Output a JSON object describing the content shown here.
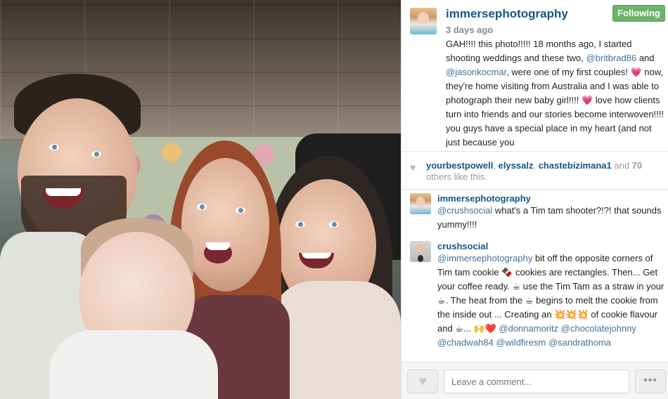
{
  "post": {
    "username": "immersephotography",
    "follow_label": "Following",
    "time_ago": "3 days ago",
    "caption": {
      "p1": "GAH!!!! this photo!!!!! 18 months ago, I started shooting weddings and these two, ",
      "m1": "@britbrad86",
      "p2": " and ",
      "m2": "@jasonkocmar",
      "p3": ", were one of my first couples! ",
      "e1": "💗",
      "p4": " now, they're home visiting from Australia and I was able to photograph their new baby girl!!!! ",
      "e2": "💗",
      "p5": " love how clients turn into friends and our stories become interwoven!!!! you guys have a special place in my heart (and not just because you"
    }
  },
  "likes": {
    "users": [
      "yourbestpowell",
      "elyssalz",
      "chastebizimana1"
    ],
    "sep": ", ",
    "and": " and ",
    "count": "70",
    "suffix": " others like this."
  },
  "comments": [
    {
      "user": "immersephotography",
      "mention": "@crushsocial",
      "text": " what's a Tim tam shooter?!?! that sounds yummy!!!!"
    },
    {
      "user": "crushsocial",
      "mention": "@immersephotography",
      "t1": " bit off the opposite corners of Tim tam cookie 🍫 cookies are rectangles. Then... Get your coffee ready. ☕ use the Tim Tam as a straw in your ☕. The heat from the ☕ begins to melt the cookie from the inside out ... Creating an 💥💥💥 of cookie flavour and ☕... 🙌❤️ ",
      "mentions": [
        "@donnamoritz",
        "@chocolatejohnny",
        "@chadwah84",
        "@wildfiresm",
        "@sandrathoma"
      ]
    }
  ],
  "footer": {
    "comment_placeholder": "Leave a comment...",
    "more_label": "•••",
    "like_icon": "heart-icon"
  },
  "colors": {
    "username_blue": "#125688",
    "mention_blue": "#3f729b",
    "follow_green": "#6bb36b"
  }
}
